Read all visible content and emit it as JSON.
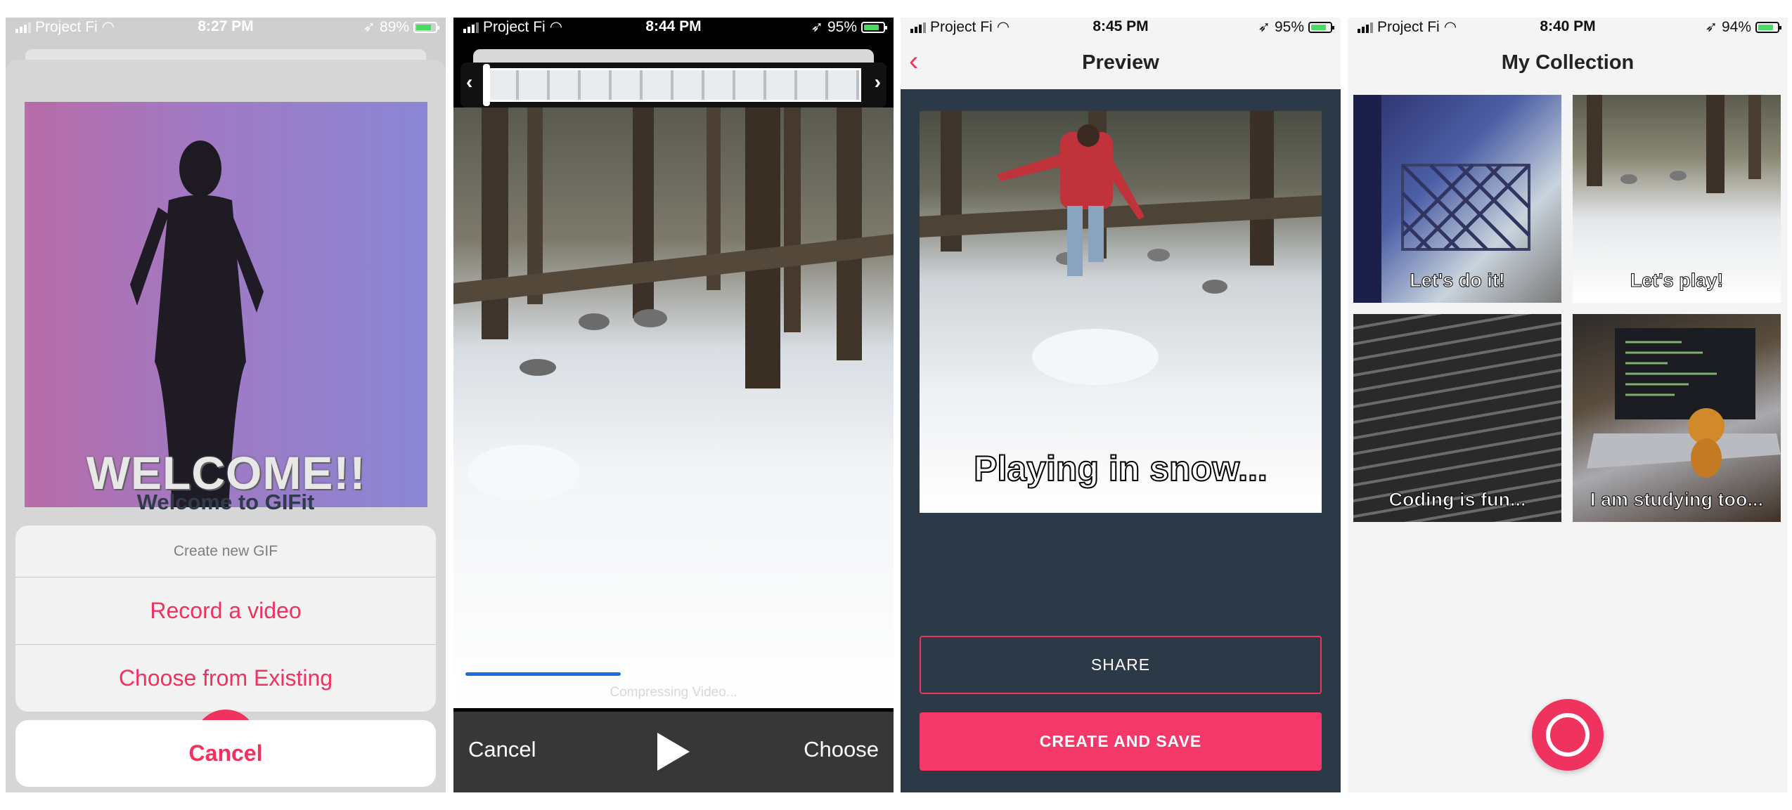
{
  "screens": [
    {
      "status": {
        "carrier": "Project Fi",
        "time": "8:27 PM",
        "battery": "89%"
      },
      "welcome_overlay_text": "WELCOME!!",
      "title": "Welcome to GIFit",
      "action_sheet": {
        "header": "Create new GIF",
        "options": [
          "Record a video",
          "Choose from Existing"
        ],
        "cancel_label": "Cancel"
      }
    },
    {
      "status": {
        "carrier": "Project Fi",
        "time": "8:44 PM",
        "battery": "95%"
      },
      "progress_fraction": 0.37,
      "progress_label": "Compressing Video...",
      "toolbar": {
        "cancel_label": "Cancel",
        "choose_label": "Choose"
      }
    },
    {
      "status": {
        "carrier": "Project Fi",
        "time": "8:45 PM",
        "battery": "95%"
      },
      "nav_title": "Preview",
      "caption": "Playing in snow...",
      "share_label": "SHARE",
      "save_label": "CREATE AND SAVE"
    },
    {
      "status": {
        "carrier": "Project Fi",
        "time": "8:40 PM",
        "battery": "94%"
      },
      "nav_title": "My Collection",
      "gifs": [
        {
          "caption": "Let's do it!"
        },
        {
          "caption": "Let's play!"
        },
        {
          "caption": "Coding is fun..."
        },
        {
          "caption": "I am studying too..."
        }
      ]
    }
  ],
  "colors": {
    "accent": "#f0325e",
    "dark_bg": "#2c3a47",
    "progress": "#1a6fe0"
  }
}
